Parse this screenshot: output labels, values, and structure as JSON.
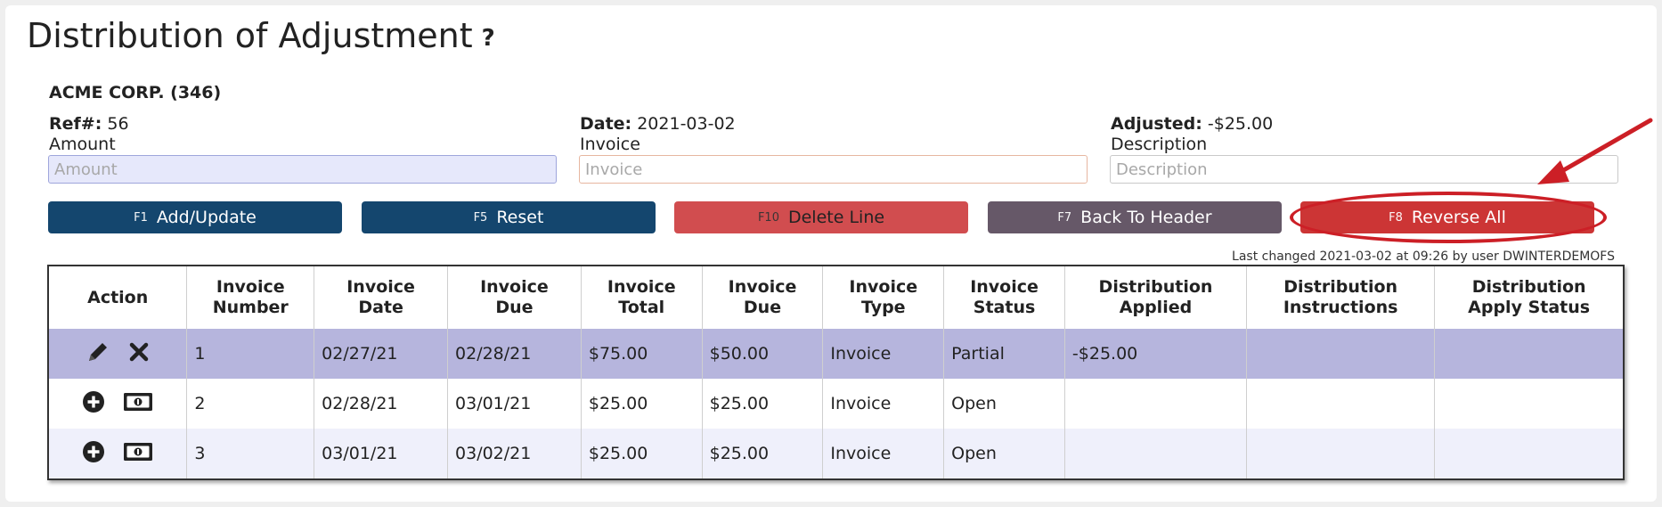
{
  "header": {
    "title": "Distribution of Adjustment",
    "help": "?"
  },
  "company": "ACME CORP. (346)",
  "meta": {
    "ref_label": "Ref#:",
    "ref_value": "56",
    "date_label": "Date:",
    "date_value": "2021-03-02",
    "adjusted_label": "Adjusted:",
    "adjusted_value": "-$25.00"
  },
  "fields": {
    "amount": {
      "label": "Amount",
      "placeholder": "Amount",
      "value": ""
    },
    "invoice": {
      "label": "Invoice",
      "placeholder": "Invoice",
      "value": ""
    },
    "description": {
      "label": "Description",
      "placeholder": "Description",
      "value": ""
    }
  },
  "buttons": {
    "add": {
      "key": "F1",
      "label": "Add/Update"
    },
    "reset": {
      "key": "F5",
      "label": "Reset"
    },
    "delete": {
      "key": "F10",
      "label": "Delete Line"
    },
    "back": {
      "key": "F7",
      "label": "Back To Header"
    },
    "reverse": {
      "key": "F8",
      "label": "Reverse All"
    }
  },
  "last_changed": "Last changed 2021-03-02 at 09:26 by user DWINTERDEMOFS",
  "table": {
    "headers": [
      [
        "Action"
      ],
      [
        "Invoice",
        "Number"
      ],
      [
        "Invoice",
        "Date"
      ],
      [
        "Invoice",
        "Due"
      ],
      [
        "Invoice",
        "Total"
      ],
      [
        "Invoice",
        "Due"
      ],
      [
        "Invoice",
        "Type"
      ],
      [
        "Invoice",
        "Status"
      ],
      [
        "Distribution",
        "Applied"
      ],
      [
        "Distribution",
        "Instructions"
      ],
      [
        "Distribution",
        "Apply Status"
      ]
    ],
    "rows": [
      {
        "actions": [
          "pencil-icon",
          "x-icon"
        ],
        "cells": [
          "1",
          "02/27/21",
          "02/28/21",
          "$75.00",
          "$50.00",
          "Invoice",
          "Partial",
          "-$25.00",
          "",
          ""
        ]
      },
      {
        "actions": [
          "plus-circle-icon",
          "money-icon"
        ],
        "cells": [
          "2",
          "02/28/21",
          "03/01/21",
          "$25.00",
          "$25.00",
          "Invoice",
          "Open",
          "",
          "",
          ""
        ]
      },
      {
        "actions": [
          "plus-circle-icon",
          "money-icon"
        ],
        "cells": [
          "3",
          "03/01/21",
          "03/02/21",
          "$25.00",
          "$25.00",
          "Invoice",
          "Open",
          "",
          "",
          ""
        ]
      }
    ]
  },
  "colors": {
    "primary_button": "#14466e",
    "delete_button": "#d14d4f",
    "back_button": "#665868",
    "reverse_button": "#cc3535",
    "selected_row": "#b6b5dd",
    "annotation": "#cc1f26"
  }
}
